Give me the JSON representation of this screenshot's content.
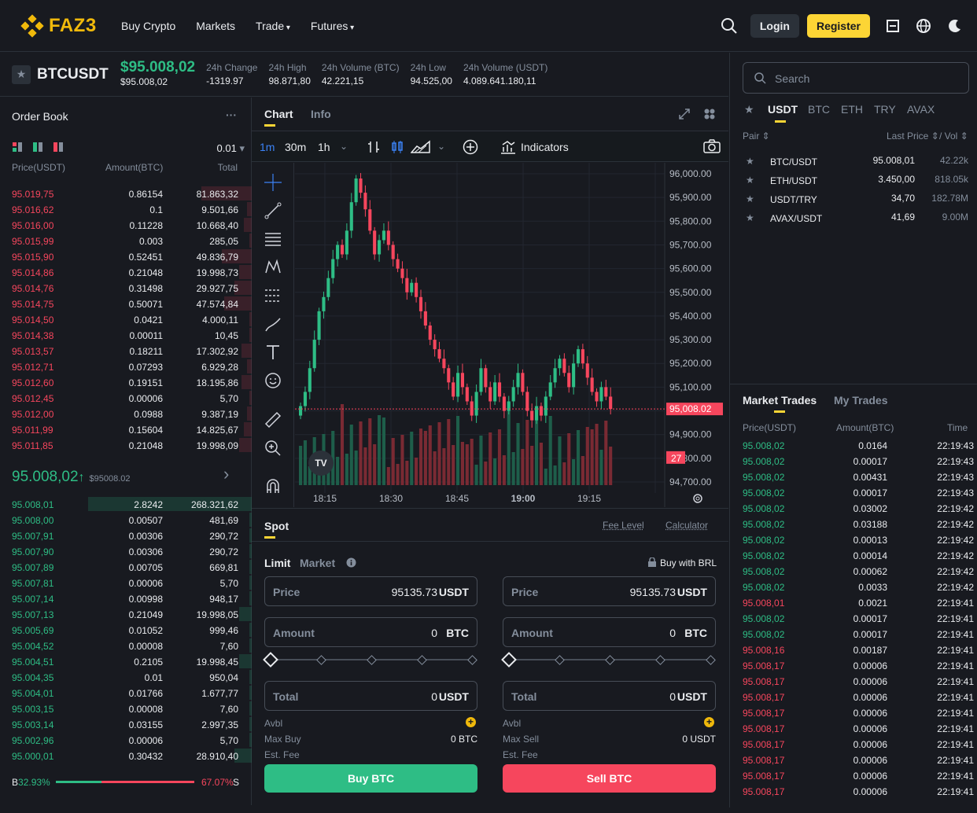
{
  "header": {
    "brand": "FAZ3",
    "nav": [
      "Buy Crypto",
      "Markets",
      "Trade",
      "Futures"
    ],
    "login": "Login",
    "register": "Register"
  },
  "ticker": {
    "symbol": "BTCUSDT",
    "price": "$95.008,02",
    "price_sub": "$95.008,02",
    "stats": [
      {
        "label": "24h Change",
        "value": "-1319.97"
      },
      {
        "label": "24h High",
        "value": "98.871,80"
      },
      {
        "label": "24h Volume (BTC)",
        "value": "42.221,15"
      },
      {
        "label": "24h Low",
        "value": "94.525,00"
      },
      {
        "label": "24h Volume (USDT)",
        "value": "4.089.641.180,11"
      }
    ]
  },
  "orderbook": {
    "title": "Order Book",
    "menu": "···",
    "precision": "0.01",
    "cols": [
      "Price(USDT)",
      "Amount(BTC)",
      "Total"
    ],
    "asks": [
      [
        "95.019,75",
        "0.86154",
        "81.863,32"
      ],
      [
        "95.016,62",
        "0.1",
        "9.501,66"
      ],
      [
        "95.016,00",
        "0.11228",
        "10.668,40"
      ],
      [
        "95.015,99",
        "0.003",
        "285,05"
      ],
      [
        "95.015,90",
        "0.52451",
        "49.836,79"
      ],
      [
        "95.014,86",
        "0.21048",
        "19.998,73"
      ],
      [
        "95.014,76",
        "0.31498",
        "29.927,75"
      ],
      [
        "95.014,75",
        "0.50071",
        "47.574,84"
      ],
      [
        "95.014,50",
        "0.0421",
        "4.000,11"
      ],
      [
        "95.014,38",
        "0.00011",
        "10,45"
      ],
      [
        "95.013,57",
        "0.18211",
        "17.302,92"
      ],
      [
        "95.012,71",
        "0.07293",
        "6.929,28"
      ],
      [
        "95.012,60",
        "0.19151",
        "18.195,86"
      ],
      [
        "95.012,45",
        "0.00006",
        "5,70"
      ],
      [
        "95.012,00",
        "0.0988",
        "9.387,19"
      ],
      [
        "95.011,99",
        "0.15604",
        "14.825,67"
      ],
      [
        "95.011,85",
        "0.21048",
        "19.998,09"
      ]
    ],
    "ask_depth": [
      0.2,
      0.02,
      0.03,
      0.01,
      0.12,
      0.05,
      0.07,
      0.11,
      0.01,
      0.01,
      0.04,
      0.02,
      0.04,
      0.01,
      0.02,
      0.03,
      0.05
    ],
    "mid_price": "95.008,02",
    "mid_arrow": "↑",
    "mid_sub": "$95008.02",
    "mid_chevron": "›",
    "bids": [
      [
        "95.008,01",
        "2.8242",
        "268.321,62"
      ],
      [
        "95.008,00",
        "0.00507",
        "481,69"
      ],
      [
        "95.007,91",
        "0.00306",
        "290,72"
      ],
      [
        "95.007,90",
        "0.00306",
        "290,72"
      ],
      [
        "95.007,89",
        "0.00705",
        "669,81"
      ],
      [
        "95.007,81",
        "0.00006",
        "5,70"
      ],
      [
        "95.007,14",
        "0.00998",
        "948,17"
      ],
      [
        "95.007,13",
        "0.21049",
        "19.998,05"
      ],
      [
        "95.005,69",
        "0.01052",
        "999,46"
      ],
      [
        "95.004,52",
        "0.00008",
        "7,60"
      ],
      [
        "95.004,51",
        "0.2105",
        "19.998,45"
      ],
      [
        "95.004,35",
        "0.01",
        "950,04"
      ],
      [
        "95.004,01",
        "0.01766",
        "1.677,77"
      ],
      [
        "95.003,15",
        "0.00008",
        "7,60"
      ],
      [
        "95.003,14",
        "0.03155",
        "2.997,35"
      ],
      [
        "95.002,96",
        "0.00006",
        "5,70"
      ],
      [
        "95.000,01",
        "0.30432",
        "28.910,40"
      ]
    ],
    "bid_depth": [
      0.65,
      0.01,
      0.01,
      0.01,
      0.01,
      0.01,
      0.01,
      0.05,
      0.01,
      0.01,
      0.05,
      0.01,
      0.01,
      0.01,
      0.01,
      0.01,
      0.07
    ],
    "ratio_b_label": "B",
    "ratio_b": "32.93%",
    "ratio_s": "67.07%",
    "ratio_s_label": "S",
    "ratio_b_value": 32.93
  },
  "chart": {
    "tabs": [
      "Chart",
      "Info"
    ],
    "intervals": [
      "1m",
      "30m",
      "1h"
    ],
    "indicators": "Indicators",
    "y_ticks": [
      "96,000.00",
      "95,900.00",
      "95,800.00",
      "95,700.00",
      "95,600.00",
      "95,500.00",
      "95,400.00",
      "95,300.00",
      "95,200.00",
      "95,100.00",
      "95,008.02",
      "94,900.00",
      "94,800.00",
      "94,700.00"
    ],
    "x_ticks": [
      "18:15",
      "18:30",
      "18:45",
      "19:00",
      "19:15"
    ],
    "last_price": "95,008.02",
    "countdown": "27"
  },
  "chart_data": {
    "type": "candlestick",
    "ylim": [
      94700,
      96000
    ],
    "last": 95008.02,
    "closes": [
      95020,
      95080,
      95180,
      95300,
      95420,
      95480,
      95560,
      95640,
      95700,
      95660,
      95760,
      95880,
      95980,
      95920,
      95850,
      95760,
      95660,
      95720,
      95760,
      95700,
      95640,
      95600,
      95560,
      95500,
      95540,
      95480,
      95420,
      95360,
      95300,
      95260,
      95220,
      95180,
      95120,
      95060,
      95160,
      95100,
      95040,
      94980,
      95080,
      95180,
      95100,
      95040,
      95120,
      95060,
      95000,
      95040,
      95100,
      95160,
      95080,
      95000,
      94960,
      95020,
      94980,
      95060,
      95120,
      95180,
      95220,
      95160,
      95100,
      95200,
      95260,
      95200,
      95140,
      95080,
      95040,
      95100,
      95060,
      95008
    ]
  },
  "spot": {
    "title": "Spot",
    "fee_level": "Fee Level",
    "calculator": "Calculator",
    "order_types": [
      "Limit",
      "Market"
    ],
    "buy_with": "Buy with BRL",
    "buy": {
      "price_label": "Price",
      "price": "95135.73",
      "price_unit": "USDT",
      "amount_label": "Amount",
      "amount": "0",
      "amount_unit": "BTC",
      "total_label": "Total",
      "total": "0",
      "total_unit": "USDT",
      "avbl": "Avbl",
      "max_label": "Max Buy",
      "max_value": "0 BTC",
      "fee": "Est. Fee",
      "button": "Buy BTC"
    },
    "sell": {
      "price_label": "Price",
      "price": "95135.73",
      "price_unit": "USDT",
      "amount_label": "Amount",
      "amount": "0",
      "amount_unit": "BTC",
      "total_label": "Total",
      "total": "0",
      "total_unit": "USDT",
      "avbl": "Avbl",
      "max_label": "Max Sell",
      "max_value": "0 USDT",
      "fee": "Est. Fee",
      "button": "Sell BTC"
    }
  },
  "markets": {
    "search_placeholder": "Search",
    "tabs": [
      "USDT",
      "BTC",
      "ETH",
      "TRY",
      "AVAX"
    ],
    "cols": [
      "Pair",
      "Last Price",
      "/ Vol"
    ],
    "rows": [
      [
        "BTC/USDT",
        "95.008,01",
        "42.22k"
      ],
      [
        "ETH/USDT",
        "3.450,00",
        "818.05k"
      ],
      [
        "USDT/TRY",
        "34,70",
        "182.78M"
      ],
      [
        "AVAX/USDT",
        "41,69",
        "9.00M"
      ]
    ]
  },
  "trades": {
    "tabs": [
      "Market Trades",
      "My Trades"
    ],
    "cols": [
      "Price(USDT)",
      "Amount(BTC)",
      "Time"
    ],
    "rows": [
      [
        "95.008,02",
        "0.0164",
        "22:19:43",
        "g"
      ],
      [
        "95.008,02",
        "0.00017",
        "22:19:43",
        "g"
      ],
      [
        "95.008,02",
        "0.00431",
        "22:19:43",
        "g"
      ],
      [
        "95.008,02",
        "0.00017",
        "22:19:43",
        "g"
      ],
      [
        "95.008,02",
        "0.03002",
        "22:19:42",
        "g"
      ],
      [
        "95.008,02",
        "0.03188",
        "22:19:42",
        "g"
      ],
      [
        "95.008,02",
        "0.00013",
        "22:19:42",
        "g"
      ],
      [
        "95.008,02",
        "0.00014",
        "22:19:42",
        "g"
      ],
      [
        "95.008,02",
        "0.00062",
        "22:19:42",
        "g"
      ],
      [
        "95.008,02",
        "0.0033",
        "22:19:42",
        "g"
      ],
      [
        "95.008,01",
        "0.0021",
        "22:19:41",
        "r"
      ],
      [
        "95.008,02",
        "0.00017",
        "22:19:41",
        "g"
      ],
      [
        "95.008,02",
        "0.00017",
        "22:19:41",
        "g"
      ],
      [
        "95.008,16",
        "0.00187",
        "22:19:41",
        "r"
      ],
      [
        "95.008,17",
        "0.00006",
        "22:19:41",
        "r"
      ],
      [
        "95.008,17",
        "0.00006",
        "22:19:41",
        "r"
      ],
      [
        "95.008,17",
        "0.00006",
        "22:19:41",
        "r"
      ],
      [
        "95.008,17",
        "0.00006",
        "22:19:41",
        "r"
      ],
      [
        "95.008,17",
        "0.00006",
        "22:19:41",
        "r"
      ],
      [
        "95.008,17",
        "0.00006",
        "22:19:41",
        "r"
      ],
      [
        "95.008,17",
        "0.00006",
        "22:19:41",
        "r"
      ],
      [
        "95.008,17",
        "0.00006",
        "22:19:41",
        "r"
      ],
      [
        "95.008,17",
        "0.00006",
        "22:19:41",
        "r"
      ]
    ]
  },
  "colors": {
    "green": "#2ebd85",
    "red": "#f6465d",
    "yellow": "#fcd535",
    "bg": "#181a20"
  }
}
